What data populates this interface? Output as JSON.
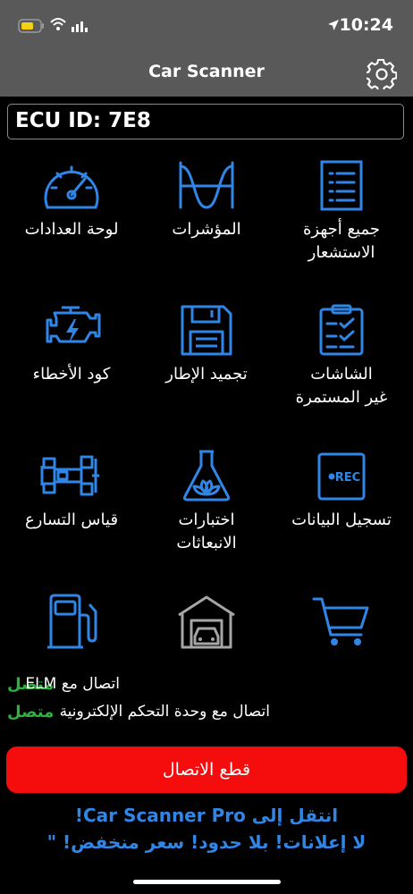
{
  "status_bar": {
    "time": "10:24"
  },
  "nav": {
    "title": "Car Scanner",
    "settings_icon": "gear-icon"
  },
  "ecu": {
    "label": "ECU ID: 7E8"
  },
  "tiles": [
    {
      "label": "لوحة العدادات",
      "icon": "speedometer-icon"
    },
    {
      "label": "المؤشرات",
      "icon": "sine-wave-icon"
    },
    {
      "label": "جميع أجهزة\nالاستشعار",
      "icon": "list-icon"
    },
    {
      "label": "كود الأخطاء",
      "icon": "engine-icon"
    },
    {
      "label": "تجميد الإطار",
      "icon": "floppy-disk-icon"
    },
    {
      "label": "الشاشات\nغير المستمرة",
      "icon": "clipboard-check-icon"
    },
    {
      "label": "قياس التسارع",
      "icon": "race-car-icon"
    },
    {
      "label": "اختبارات\nالانبعاثات",
      "icon": "flask-leaf-icon"
    },
    {
      "label": "تسجيل البيانات",
      "icon": "rec-icon",
      "rec_text": "REC"
    },
    {
      "label": "",
      "icon": "fuel-pump-icon"
    },
    {
      "label": "",
      "icon": "garage-icon"
    },
    {
      "label": "",
      "icon": "cart-icon"
    }
  ],
  "connections": [
    {
      "label": "اتصال مع ELM",
      "status": "متصل"
    },
    {
      "label": "اتصال مع وحدة التحكم الإلكترونية",
      "status": "متصل"
    }
  ],
  "disconnect_label": "قطع الاتصال",
  "promo": {
    "line1": "انتقل إلى Car Scanner Pro!",
    "line2": "لا إعلانات! بلا حدود!  سعر منخفض! \""
  },
  "colors": {
    "accent": "#2f86e6",
    "bar": "#595959",
    "danger": "#f50d0d",
    "ok": "#2fb03f"
  }
}
